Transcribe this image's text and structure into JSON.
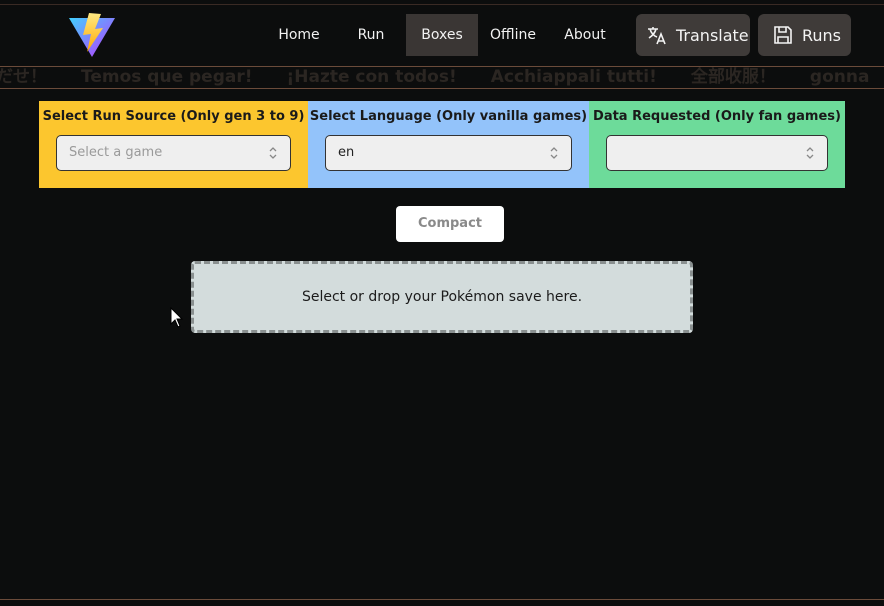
{
  "nav": {
    "home": "Home",
    "run": "Run",
    "boxes": "Boxes",
    "offline": "Offline",
    "about": "About"
  },
  "header_buttons": {
    "translate": "Translate",
    "runs": "Runs"
  },
  "marquee": [
    "だせ！",
    "Temos que pegar!",
    "¡Hazte con todos!",
    "Acchiappali tutti!",
    "全部收服！",
    "gonna"
  ],
  "panels": {
    "run_source": {
      "label": "Select Run Source (Only gen 3 to 9)",
      "placeholder": "Select a game",
      "color": "#fcc62e"
    },
    "language": {
      "label": "Select Language (Only vanilla games)",
      "value": "en",
      "color": "#93c3fa"
    },
    "data_requested": {
      "label": "Data Requested (Only fan games)",
      "value": "",
      "color": "#6ddb9a"
    }
  },
  "compact_button": "Compact",
  "drop_zone": "Select or drop your Pokémon save here.",
  "icons": {
    "logo": "vite-logo",
    "translate": "translate-icon",
    "runs": "save-icon"
  }
}
